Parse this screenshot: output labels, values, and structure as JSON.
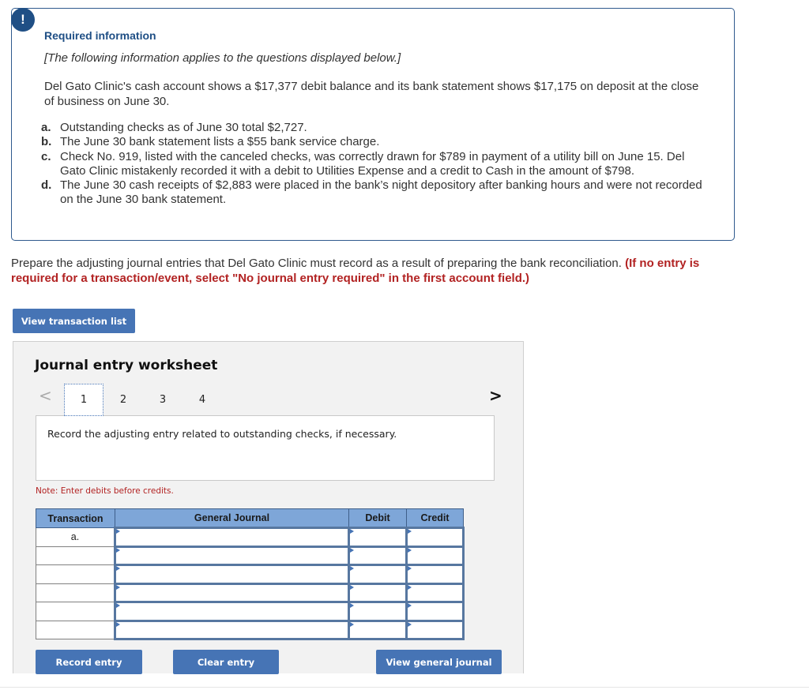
{
  "required_info": {
    "alert_icon_glyph": "!",
    "title": "Required information",
    "subtitle": "[The following information applies to the questions displayed below.]",
    "intro": "Del Gato Clinic's cash account shows a $17,377 debit balance and its bank statement shows $17,175 on deposit at the close of business on June 30.",
    "items": [
      {
        "letter": "a.",
        "text": "Outstanding checks as of June 30 total $2,727."
      },
      {
        "letter": "b.",
        "text": "The June 30 bank statement lists a $55 bank service charge."
      },
      {
        "letter": "c.",
        "text": "Check No. 919, listed with the canceled checks, was correctly drawn for $789 in payment of a utility bill on June 15. Del Gato Clinic mistakenly recorded it with a debit to Utilities Expense and a credit to Cash in the amount of $798."
      },
      {
        "letter": "d.",
        "text": "The June 30 cash receipts of $2,883 were placed in the bank’s night depository after banking hours and were not recorded on the June 30 bank statement."
      }
    ]
  },
  "instructions": {
    "text": "Prepare the adjusting journal entries that Del Gato Clinic must record as a result of preparing the bank reconciliation. ",
    "emphasis": "(If no entry is required for a transaction/event, select \"No journal entry required\" in the first account field.)"
  },
  "buttons": {
    "view_transaction_list": "View transaction list",
    "record_entry": "Record entry",
    "clear_entry": "Clear entry",
    "view_general_journal": "View general journal"
  },
  "worksheet": {
    "title": "Journal entry worksheet",
    "prev_glyph": "<",
    "next_glyph": ">",
    "tabs": [
      "1",
      "2",
      "3",
      "4"
    ],
    "active_tab": "1",
    "prompt": "Record the adjusting entry related to outstanding checks, if necessary.",
    "note": "Note: Enter debits before credits.",
    "table": {
      "headers": {
        "transaction": "Transaction",
        "general_journal": "General Journal",
        "debit": "Debit",
        "credit": "Credit"
      },
      "rows": [
        {
          "transaction": "a.",
          "account": "",
          "debit": "",
          "credit": ""
        },
        {
          "transaction": "",
          "account": "",
          "debit": "",
          "credit": ""
        },
        {
          "transaction": "",
          "account": "",
          "debit": "",
          "credit": ""
        },
        {
          "transaction": "",
          "account": "",
          "debit": "",
          "credit": ""
        },
        {
          "transaction": "",
          "account": "",
          "debit": "",
          "credit": ""
        },
        {
          "transaction": "",
          "account": "",
          "debit": "",
          "credit": ""
        }
      ]
    }
  }
}
